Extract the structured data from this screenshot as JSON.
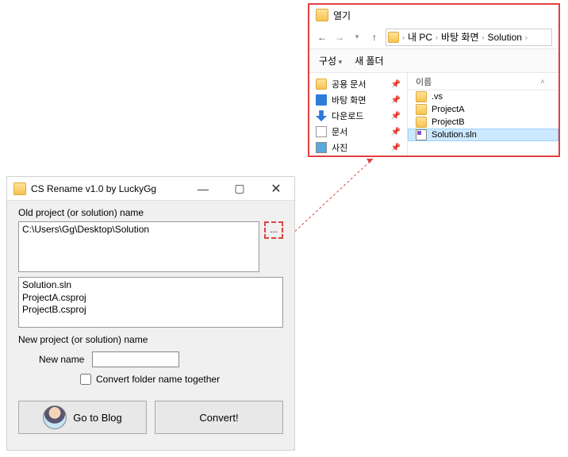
{
  "app": {
    "title": "CS Rename v1.0 by LuckyGg",
    "old_label": "Old project (or solution) name",
    "path_value": "C:\\Users\\Gg\\Desktop\\Solution",
    "browse_label": "...",
    "file_list": [
      "Solution.sln",
      "ProjectA.csproj",
      "ProjectB.csproj"
    ],
    "new_label": "New project (or solution) name",
    "new_name_label": "New name",
    "new_name_value": "",
    "checkbox_label": "Convert folder name together",
    "blog_btn": "Go to Blog",
    "convert_btn": "Convert!"
  },
  "dialog": {
    "title": "열기",
    "breadcrumbs": [
      "내 PC",
      "바탕 화면",
      "Solution"
    ],
    "toolbar": {
      "organize": "구성",
      "new_folder": "새 폴더"
    },
    "sidebar": [
      {
        "icon": "share-icon",
        "label": "공용 문서"
      },
      {
        "icon": "desk-icon",
        "label": "바탕 화면"
      },
      {
        "icon": "dl-icon",
        "label": "다운로드"
      },
      {
        "icon": "doc-icon",
        "label": "문서"
      },
      {
        "icon": "pic-icon",
        "label": "사진"
      }
    ],
    "column_header": "이름",
    "files": [
      {
        "icon": "folder-icon",
        "name": ".vs",
        "selected": false
      },
      {
        "icon": "folder-icon",
        "name": "ProjectA",
        "selected": false
      },
      {
        "icon": "folder-icon",
        "name": "ProjectB",
        "selected": false
      },
      {
        "icon": "sln-icon",
        "name": "Solution.sln",
        "selected": true
      }
    ]
  }
}
